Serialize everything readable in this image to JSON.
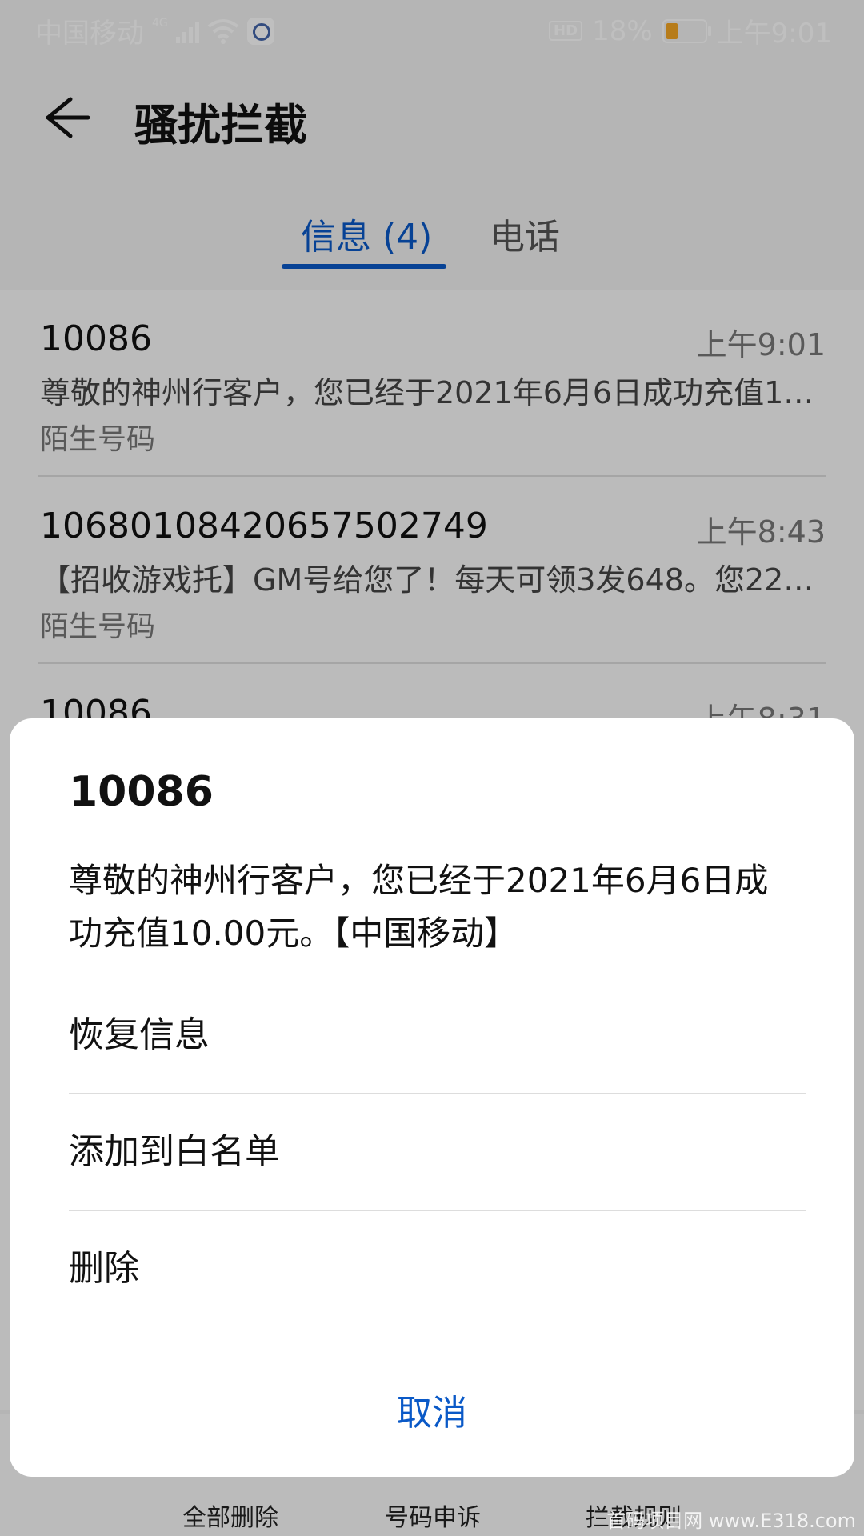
{
  "statusbar": {
    "carrier": "中国移动",
    "network": "4G",
    "hd": "HD",
    "battery": "18%",
    "time": "上午9:01"
  },
  "header": {
    "title": "骚扰拦截"
  },
  "tabs": [
    {
      "label": "信息 (4)",
      "active": true
    },
    {
      "label": "电话",
      "active": false
    }
  ],
  "messages": [
    {
      "sender": "10086",
      "time": "上午9:01",
      "preview": "尊敬的神州行客户，您已经于2021年6月6日成功充值10...",
      "tag": "陌生号码"
    },
    {
      "sender": "10680108420657502749",
      "time": "上午8:43",
      "preview": "【招收游戏托】GM号给您了！每天可领3发648。您221...",
      "tag": "陌生号码"
    },
    {
      "sender": "10086",
      "time": "上午8:31",
      "preview": "",
      "tag": ""
    }
  ],
  "toolbar": {
    "delete_all": "全部删除",
    "appeal": "号码申诉",
    "rules": "拦截规则"
  },
  "dialog": {
    "title": "10086",
    "body": "尊敬的神州行客户，您已经于2021年6月6日成功充值10.00元。【中国移动】",
    "restore": "恢复信息",
    "whitelist": "添加到白名单",
    "delete": "删除",
    "cancel": "取消"
  },
  "watermark": "首码项目网 www.E318.com",
  "colors": {
    "accent": "#0a59c7"
  }
}
